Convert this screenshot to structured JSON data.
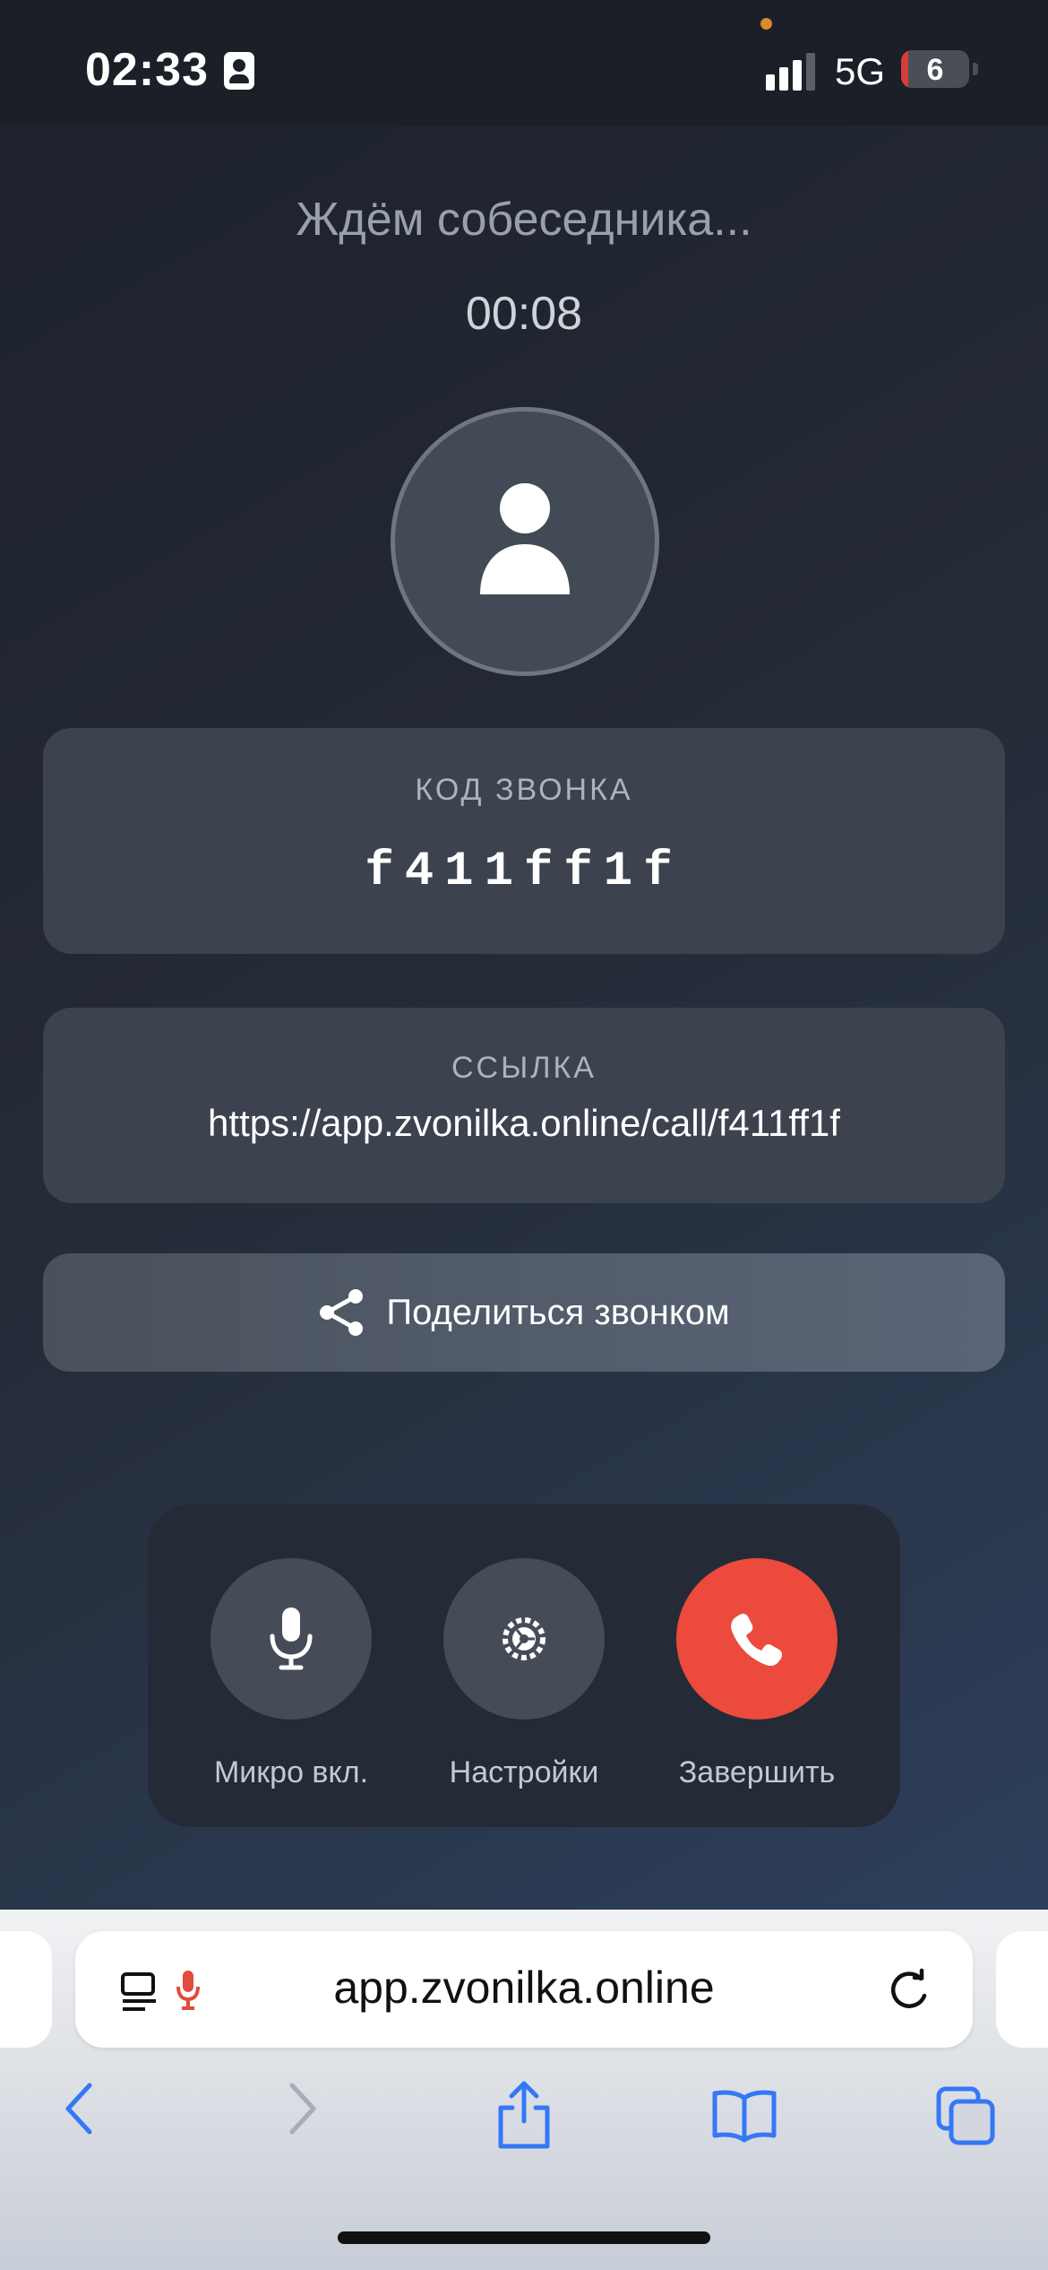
{
  "status": {
    "time": "02:33",
    "network": "5G",
    "battery": "6"
  },
  "call": {
    "waiting": "Ждём собеседника...",
    "timer": "00:08",
    "code_label": "КОД ЗВОНКА",
    "code": "f411ff1f",
    "link_label": "ССЫЛКА",
    "link": "https://app.zvonilka.online/call/f411ff1f",
    "share": "Поделиться звонком"
  },
  "controls": {
    "mic": "Микро вкл.",
    "settings": "Настройки",
    "end": "Завершить"
  },
  "browser": {
    "url": "app.zvonilka.online"
  },
  "colors": {
    "end_call": "#eb4a3c",
    "safari_blue": "#3478f6"
  }
}
